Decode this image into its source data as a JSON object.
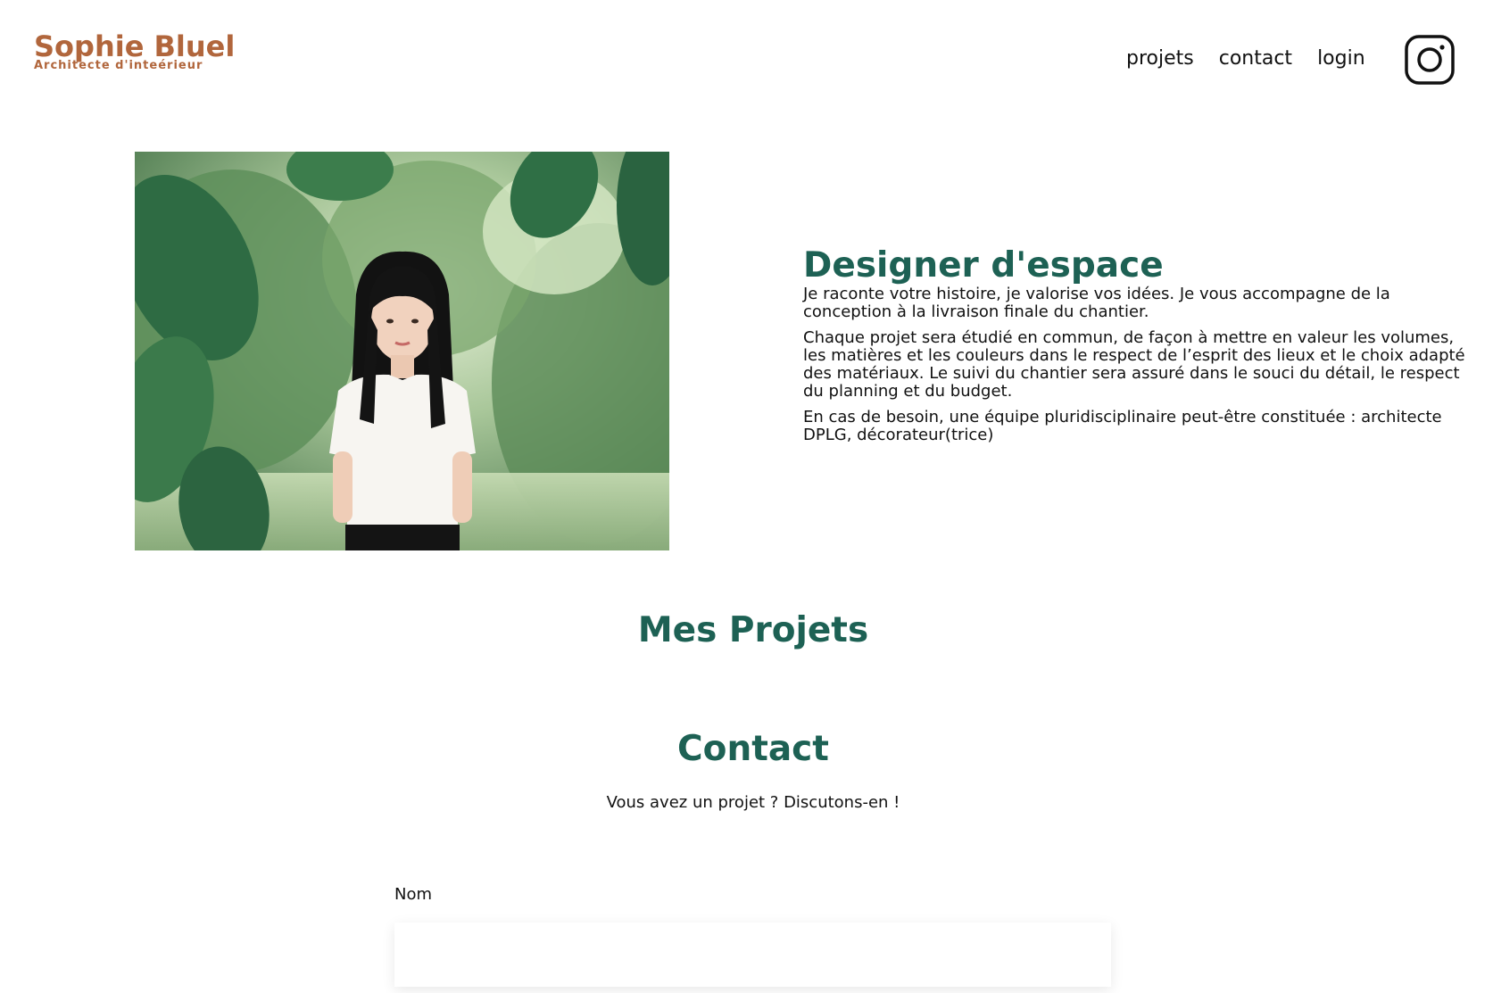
{
  "header": {
    "brand_name": "Sophie Bluel",
    "brand_tagline": "Architecte d'inteérieur",
    "nav": {
      "projects": "projets",
      "contact": "contact",
      "login": "login"
    },
    "instagram_icon": "instagram-icon"
  },
  "introduction": {
    "photo_icon": "portrait-photo",
    "title": "Designer d'espace",
    "paragraphs": [
      "Je raconte votre histoire, je valorise vos idées. Je vous accompagne de la conception à la livraison finale du chantier.",
      "Chaque projet sera étudié en commun, de façon à mettre en valeur les volumes, les matières et les couleurs dans le respect de l’esprit des lieux et le choix adapté des matériaux. Le suivi du chantier sera assuré dans le souci du détail, le respect du planning et du budget.",
      "En cas de besoin, une équipe pluridisciplinaire peut-être constituée : architecte DPLG, décorateur(trice)"
    ]
  },
  "portfolio": {
    "title": "Mes Projets"
  },
  "contact": {
    "title": "Contact",
    "subtitle": "Vous avez un projet ? Discutons-en !",
    "form": {
      "name_label": "Nom",
      "name_value": ""
    }
  },
  "colors": {
    "brand": "#B1663C",
    "accent": "#1D6154",
    "text": "#111111",
    "background": "#FFFFFF"
  }
}
